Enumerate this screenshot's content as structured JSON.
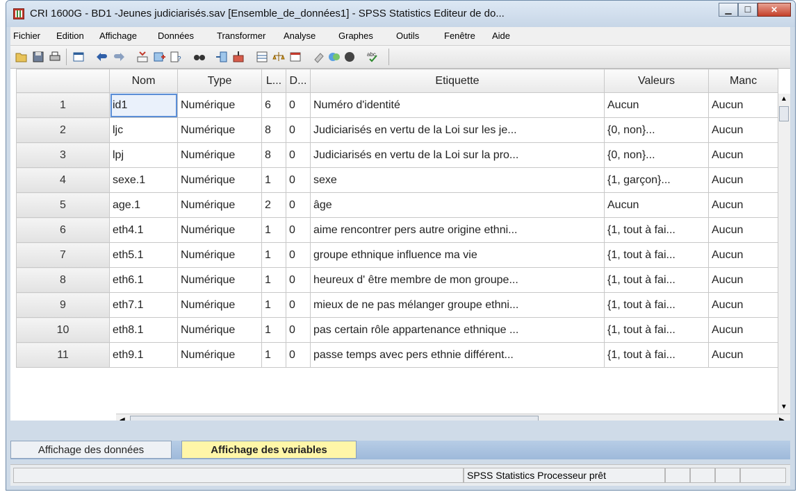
{
  "window": {
    "title": "CRI 1600G - BD1 -Jeunes judiciarisés.sav [Ensemble_de_données1] - SPSS Statistics Editeur de do...",
    "controls": [
      "minimize",
      "maximize",
      "close"
    ]
  },
  "menu": [
    "Fichier",
    "Edition",
    "Affichage",
    "Données",
    "Transformer",
    "Analyse",
    "Graphes",
    "Outils",
    "Fenêtre",
    "Aide"
  ],
  "toolbar": {
    "icons": [
      "open-icon",
      "save-icon",
      "print-icon",
      "dialog-recall-icon",
      "undo-icon",
      "redo-icon",
      "goto-case-icon",
      "insert-case-icon",
      "variables-icon",
      "find-icon",
      "insert-variable-icon",
      "split-file-icon",
      "select-cases-icon",
      "weight-cases-icon",
      "value-labels-icon",
      "use-sets-icon",
      "show-all-icon",
      "spell-check-icon"
    ]
  },
  "grid": {
    "columns": [
      "Nom",
      "Type",
      "L...",
      "D...",
      "Etiquette",
      "Valeurs",
      "Manc"
    ],
    "rows": [
      {
        "num": "1",
        "nom": "id1",
        "type": "Numérique",
        "l": "6",
        "d": "0",
        "etiquette": "Numéro d'identité",
        "valeurs": "Aucun",
        "manq": "Aucun"
      },
      {
        "num": "2",
        "nom": "ljc",
        "type": "Numérique",
        "l": "8",
        "d": "0",
        "etiquette": "Judiciarisés en vertu de la Loi sur les je...",
        "valeurs": "{0, non}...",
        "manq": "Aucun"
      },
      {
        "num": "3",
        "nom": "lpj",
        "type": "Numérique",
        "l": "8",
        "d": "0",
        "etiquette": "Judiciarisés en vertu de la Loi sur la pro...",
        "valeurs": "{0, non}...",
        "manq": "Aucun"
      },
      {
        "num": "4",
        "nom": "sexe.1",
        "type": "Numérique",
        "l": "1",
        "d": "0",
        "etiquette": "sexe",
        "valeurs": "{1, garçon}...",
        "manq": "Aucun"
      },
      {
        "num": "5",
        "nom": "age.1",
        "type": "Numérique",
        "l": "2",
        "d": "0",
        "etiquette": "âge",
        "valeurs": "Aucun",
        "manq": "Aucun"
      },
      {
        "num": "6",
        "nom": "eth4.1",
        "type": "Numérique",
        "l": "1",
        "d": "0",
        "etiquette": "aime rencontrer pers autre origine ethni...",
        "valeurs": "{1, tout à fai...",
        "manq": "Aucun"
      },
      {
        "num": "7",
        "nom": "eth5.1",
        "type": "Numérique",
        "l": "1",
        "d": "0",
        "etiquette": "groupe ethnique influence ma vie",
        "valeurs": "{1, tout à fai...",
        "manq": "Aucun"
      },
      {
        "num": "8",
        "nom": "eth6.1",
        "type": "Numérique",
        "l": "1",
        "d": "0",
        "etiquette": "heureux d' être membre de mon groupe...",
        "valeurs": "{1, tout à fai...",
        "manq": "Aucun"
      },
      {
        "num": "9",
        "nom": "eth7.1",
        "type": "Numérique",
        "l": "1",
        "d": "0",
        "etiquette": "mieux de ne pas mélanger groupe ethni...",
        "valeurs": "{1, tout à fai...",
        "manq": "Aucun"
      },
      {
        "num": "10",
        "nom": "eth8.1",
        "type": "Numérique",
        "l": "1",
        "d": "0",
        "etiquette": "pas certain rôle appartenance ethnique ...",
        "valeurs": "{1, tout à fai...",
        "manq": "Aucun"
      },
      {
        "num": "11",
        "nom": "eth9.1",
        "type": "Numérique",
        "l": "1",
        "d": "0",
        "etiquette": "passe temps avec pers ethnie différent...",
        "valeurs": "{1, tout à fai...",
        "manq": "Aucun"
      }
    ]
  },
  "tabs": {
    "data_view": "Affichage des données",
    "variable_view": "Affichage des variables"
  },
  "status": {
    "processor": "SPSS Statistics  Processeur prêt"
  },
  "colors": {
    "active_tab": "#fff6a8",
    "selection": "#5b8ed6",
    "close_button": "#c4402a"
  }
}
